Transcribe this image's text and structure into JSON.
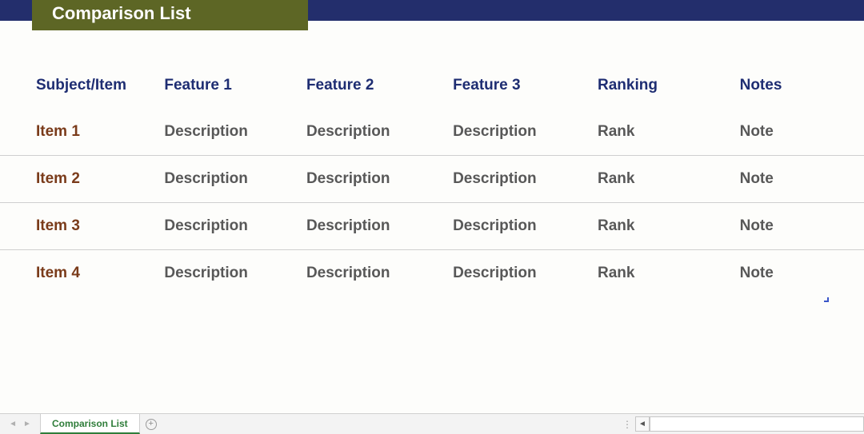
{
  "title": "Comparison List",
  "columns": [
    "Subject/Item",
    "Feature 1",
    "Feature 2",
    "Feature 3",
    "Ranking",
    "Notes"
  ],
  "rows": [
    {
      "item": "Item 1",
      "f1": "Description",
      "f2": "Description",
      "f3": "Description",
      "rank": "Rank",
      "note": "Note"
    },
    {
      "item": "Item 2",
      "f1": "Description",
      "f2": "Description",
      "f3": "Description",
      "rank": "Rank",
      "note": "Note"
    },
    {
      "item": "Item 3",
      "f1": "Description",
      "f2": "Description",
      "f3": "Description",
      "rank": "Rank",
      "note": "Note"
    },
    {
      "item": "Item 4",
      "f1": "Description",
      "f2": "Description",
      "f3": "Description",
      "rank": "Rank",
      "note": "Note"
    }
  ],
  "sheet_tab": "Comparison List"
}
